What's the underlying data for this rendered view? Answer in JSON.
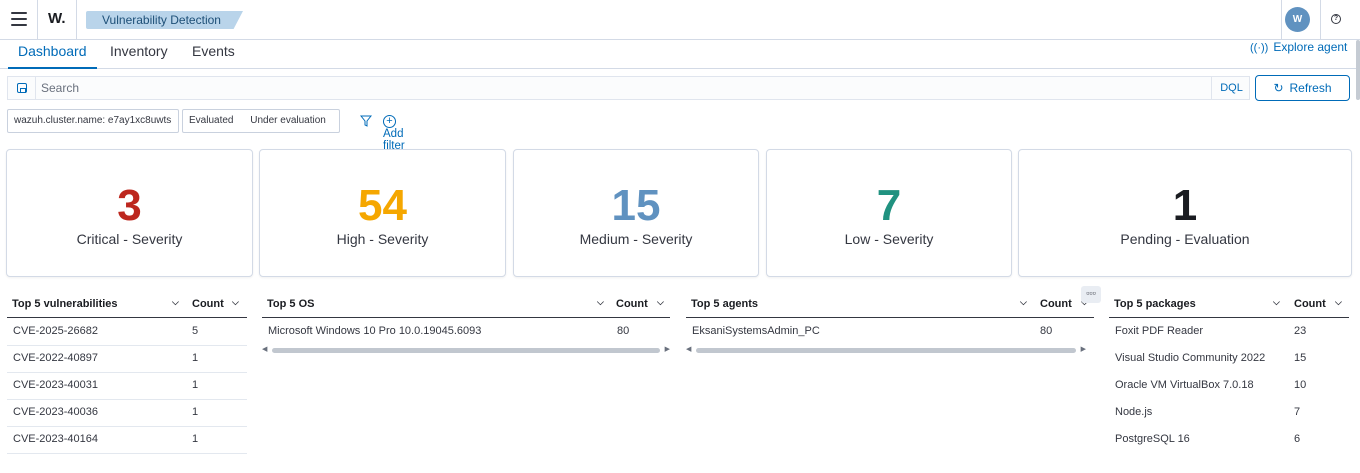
{
  "app": {
    "logo": "W.",
    "breadcrumb": "Vulnerability Detection",
    "avatar_initial": "W",
    "help_label": "?"
  },
  "tabs": [
    {
      "label": "Dashboard",
      "active": true
    },
    {
      "label": "Inventory",
      "active": false
    },
    {
      "label": "Events",
      "active": false
    }
  ],
  "explore_agent": "Explore agent",
  "search": {
    "placeholder": "Search",
    "dql": "DQL",
    "refresh": "Refresh"
  },
  "filters": {
    "cluster_pill": "wazuh.cluster.name: e7ay1xc8uwts",
    "evaluated": "Evaluated",
    "under_evaluation": "Under evaluation",
    "add_filter": "Add filter"
  },
  "cards": [
    {
      "value": "3",
      "label": "Critical - Severity",
      "color": "#bd271e"
    },
    {
      "value": "54",
      "label": "High - Severity",
      "color": "#f5a700"
    },
    {
      "value": "15",
      "label": "Medium - Severity",
      "color": "#6092c0"
    },
    {
      "value": "7",
      "label": "Low - Severity",
      "color": "#209280"
    },
    {
      "value": "1",
      "label": "Pending - Evaluation",
      "color": "#1a1c21"
    }
  ],
  "tables": {
    "vulnerabilities": {
      "title": "Top 5 vulnerabilities",
      "count_label": "Count",
      "rows": [
        {
          "name": "CVE-2025-26682",
          "count": "5"
        },
        {
          "name": "CVE-2022-40897",
          "count": "1"
        },
        {
          "name": "CVE-2023-40031",
          "count": "1"
        },
        {
          "name": "CVE-2023-40036",
          "count": "1"
        },
        {
          "name": "CVE-2023-40164",
          "count": "1"
        }
      ]
    },
    "os": {
      "title": "Top 5 OS",
      "count_label": "Count",
      "rows": [
        {
          "name": "Microsoft Windows 10 Pro 10.0.19045.6093",
          "count": "80"
        }
      ]
    },
    "agents": {
      "title": "Top 5 agents",
      "count_label": "Count",
      "rows": [
        {
          "name": "EksaniSystemsAdmin_PC",
          "count": "80"
        }
      ]
    },
    "packages": {
      "title": "Top 5 packages",
      "count_label": "Count",
      "rows": [
        {
          "name": "Foxit PDF Reader",
          "count": "23"
        },
        {
          "name": "Visual Studio Community 2022",
          "count": "15"
        },
        {
          "name": "Oracle VM VirtualBox 7.0.18",
          "count": "10"
        },
        {
          "name": "Node.js",
          "count": "7"
        },
        {
          "name": "PostgreSQL 16",
          "count": "6"
        }
      ]
    }
  }
}
